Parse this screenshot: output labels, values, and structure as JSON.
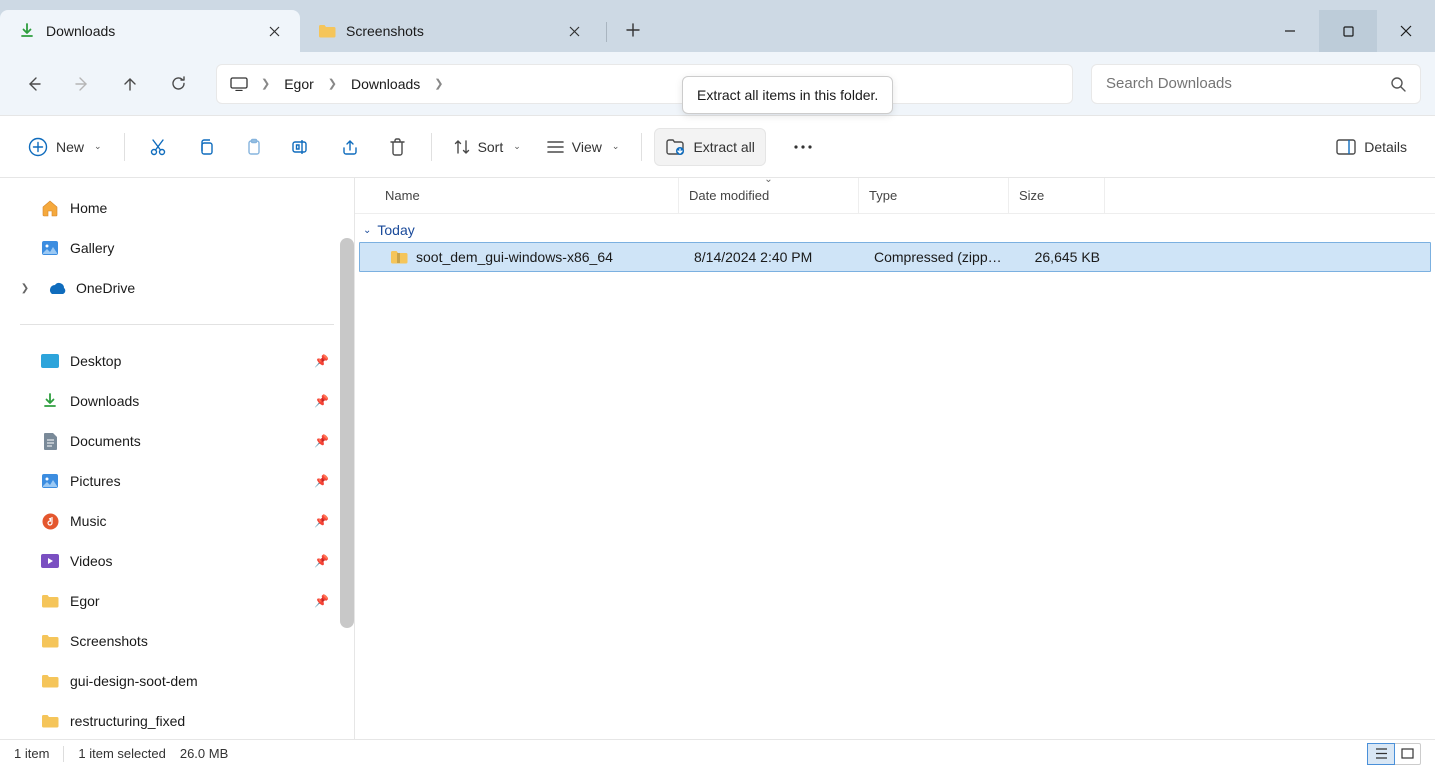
{
  "tabs": [
    {
      "title": "Downloads",
      "active": true
    },
    {
      "title": "Screenshots",
      "active": false
    }
  ],
  "breadcrumb": {
    "segments": [
      "Egor",
      "Downloads"
    ]
  },
  "search": {
    "placeholder": "Search Downloads"
  },
  "toolbar": {
    "new_label": "New",
    "sort_label": "Sort",
    "view_label": "View",
    "extract_label": "Extract all",
    "details_label": "Details"
  },
  "tooltip": "Extract all items in this folder.",
  "sidebar": {
    "top": [
      {
        "label": "Home",
        "icon": "home"
      },
      {
        "label": "Gallery",
        "icon": "gallery"
      },
      {
        "label": "OneDrive",
        "icon": "onedrive",
        "chev": true
      }
    ],
    "quick": [
      {
        "label": "Desktop",
        "icon": "desktop",
        "pinned": true
      },
      {
        "label": "Downloads",
        "icon": "downloads",
        "pinned": true
      },
      {
        "label": "Documents",
        "icon": "documents",
        "pinned": true
      },
      {
        "label": "Pictures",
        "icon": "pictures",
        "pinned": true
      },
      {
        "label": "Music",
        "icon": "music",
        "pinned": true
      },
      {
        "label": "Videos",
        "icon": "videos",
        "pinned": true
      },
      {
        "label": "Egor",
        "icon": "folder",
        "pinned": true
      },
      {
        "label": "Screenshots",
        "icon": "folder",
        "pinned": false
      },
      {
        "label": "gui-design-soot-dem",
        "icon": "folder",
        "pinned": false
      },
      {
        "label": "restructuring_fixed",
        "icon": "folder",
        "pinned": false
      }
    ]
  },
  "columns": {
    "name": "Name",
    "date": "Date modified",
    "type": "Type",
    "size": "Size"
  },
  "group": {
    "label": "Today"
  },
  "files": [
    {
      "name": "soot_dem_gui-windows-x86_64",
      "date": "8/14/2024 2:40 PM",
      "type": "Compressed (zipp…",
      "size": "26,645 KB",
      "selected": true
    }
  ],
  "status": {
    "count": "1 item",
    "selected": "1 item selected",
    "size": "26.0 MB"
  }
}
